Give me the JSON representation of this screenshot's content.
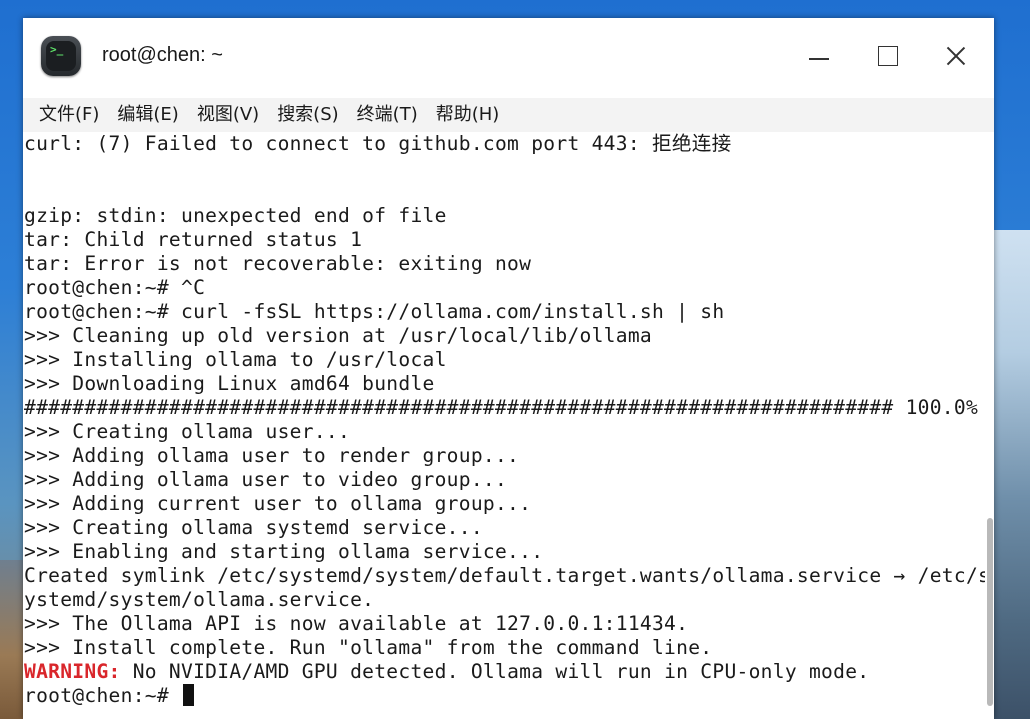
{
  "window": {
    "title": "root@chen: ~",
    "icon": "terminal-icon",
    "icon_prompt": ">_",
    "controls": [
      "minimize-icon",
      "maximize-icon",
      "close-icon"
    ]
  },
  "menu": [
    {
      "label": "文件(F)"
    },
    {
      "label": "编辑(E)"
    },
    {
      "label": "视图(V)"
    },
    {
      "label": "搜索(S)"
    },
    {
      "label": "终端(T)"
    },
    {
      "label": "帮助(H)"
    }
  ],
  "terminal": {
    "lines": [
      {
        "text": "curl: (7) Failed to connect to github.com port 443: 拒绝连接"
      },
      {
        "text": ""
      },
      {
        "text": ""
      },
      {
        "text": "gzip: stdin: unexpected end of file"
      },
      {
        "text": "tar: Child returned status 1"
      },
      {
        "text": "tar: Error is not recoverable: exiting now"
      },
      {
        "text": "root@chen:~# ^C"
      },
      {
        "text": "root@chen:~# curl -fsSL https://ollama.com/install.sh | sh"
      },
      {
        "text": ">>> Cleaning up old version at /usr/local/lib/ollama"
      },
      {
        "text": ">>> Installing ollama to /usr/local"
      },
      {
        "text": ">>> Downloading Linux amd64 bundle"
      },
      {
        "text": "######################################################################## 100.0%"
      },
      {
        "text": ">>> Creating ollama user..."
      },
      {
        "text": ">>> Adding ollama user to render group..."
      },
      {
        "text": ">>> Adding ollama user to video group..."
      },
      {
        "text": ">>> Adding current user to ollama group..."
      },
      {
        "text": ">>> Creating ollama systemd service..."
      },
      {
        "text": ">>> Enabling and starting ollama service..."
      },
      {
        "text": "Created symlink /etc/systemd/system/default.target.wants/ollama.service → /etc/s"
      },
      {
        "text": "ystemd/system/ollama.service."
      },
      {
        "text": ">>> The Ollama API is now available at 127.0.0.1:11434."
      },
      {
        "text": ">>> Install complete. Run \"ollama\" from the command line."
      }
    ],
    "warning_label": "WARNING:",
    "warning_text": " No NVIDIA/AMD GPU detected. Ollama will run in CPU-only mode.",
    "prompt": "root@chen:~# ",
    "colors": {
      "foreground": "#1a1a1a",
      "background": "#ffffff",
      "warning": "#d9262b"
    }
  }
}
